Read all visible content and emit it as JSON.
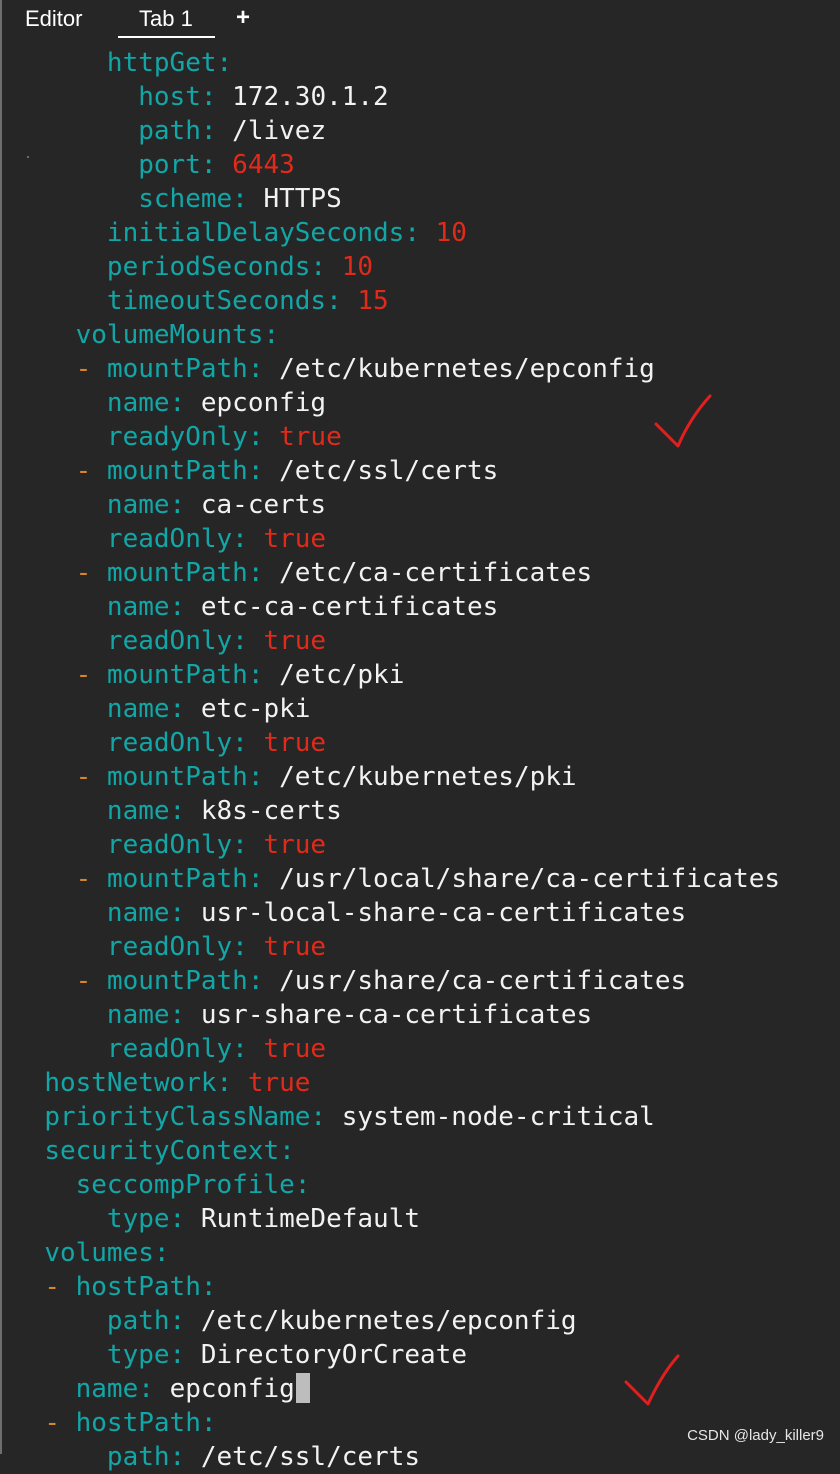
{
  "tabs": {
    "editor_label": "Editor",
    "tab1_label": "Tab 1",
    "add_label": "+"
  },
  "colors": {
    "background": "#262626",
    "key": "#12a6a7",
    "string_value": "#f2f2f2",
    "number_bool_value": "#e02a1a",
    "list_dash": "#d4862a",
    "annotation_check": "#e21f1f"
  },
  "code_lines": [
    {
      "indent": 6,
      "dash": false,
      "key": "httpGet",
      "value": "",
      "vtype": "none"
    },
    {
      "indent": 8,
      "dash": false,
      "key": "host",
      "value": "172.30.1.2",
      "vtype": "str"
    },
    {
      "indent": 8,
      "dash": false,
      "key": "path",
      "value": "/livez",
      "vtype": "str"
    },
    {
      "indent": 8,
      "dash": false,
      "key": "port",
      "value": "6443",
      "vtype": "num"
    },
    {
      "indent": 8,
      "dash": false,
      "key": "scheme",
      "value": "HTTPS",
      "vtype": "str"
    },
    {
      "indent": 6,
      "dash": false,
      "key": "initialDelaySeconds",
      "value": "10",
      "vtype": "num"
    },
    {
      "indent": 6,
      "dash": false,
      "key": "periodSeconds",
      "value": "10",
      "vtype": "num"
    },
    {
      "indent": 6,
      "dash": false,
      "key": "timeoutSeconds",
      "value": "15",
      "vtype": "num"
    },
    {
      "indent": 4,
      "dash": false,
      "key": "volumeMounts",
      "value": "",
      "vtype": "none"
    },
    {
      "indent": 4,
      "dash": true,
      "key": "mountPath",
      "value": "/etc/kubernetes/epconfig",
      "vtype": "str"
    },
    {
      "indent": 6,
      "dash": false,
      "key": "name",
      "value": "epconfig",
      "vtype": "str"
    },
    {
      "indent": 6,
      "dash": false,
      "key": "readyOnly",
      "value": "true",
      "vtype": "bool"
    },
    {
      "indent": 4,
      "dash": true,
      "key": "mountPath",
      "value": "/etc/ssl/certs",
      "vtype": "str"
    },
    {
      "indent": 6,
      "dash": false,
      "key": "name",
      "value": "ca-certs",
      "vtype": "str"
    },
    {
      "indent": 6,
      "dash": false,
      "key": "readOnly",
      "value": "true",
      "vtype": "bool"
    },
    {
      "indent": 4,
      "dash": true,
      "key": "mountPath",
      "value": "/etc/ca-certificates",
      "vtype": "str"
    },
    {
      "indent": 6,
      "dash": false,
      "key": "name",
      "value": "etc-ca-certificates",
      "vtype": "str"
    },
    {
      "indent": 6,
      "dash": false,
      "key": "readOnly",
      "value": "true",
      "vtype": "bool"
    },
    {
      "indent": 4,
      "dash": true,
      "key": "mountPath",
      "value": "/etc/pki",
      "vtype": "str"
    },
    {
      "indent": 6,
      "dash": false,
      "key": "name",
      "value": "etc-pki",
      "vtype": "str"
    },
    {
      "indent": 6,
      "dash": false,
      "key": "readOnly",
      "value": "true",
      "vtype": "bool"
    },
    {
      "indent": 4,
      "dash": true,
      "key": "mountPath",
      "value": "/etc/kubernetes/pki",
      "vtype": "str"
    },
    {
      "indent": 6,
      "dash": false,
      "key": "name",
      "value": "k8s-certs",
      "vtype": "str"
    },
    {
      "indent": 6,
      "dash": false,
      "key": "readOnly",
      "value": "true",
      "vtype": "bool"
    },
    {
      "indent": 4,
      "dash": true,
      "key": "mountPath",
      "value": "/usr/local/share/ca-certificates",
      "vtype": "str"
    },
    {
      "indent": 6,
      "dash": false,
      "key": "name",
      "value": "usr-local-share-ca-certificates",
      "vtype": "str"
    },
    {
      "indent": 6,
      "dash": false,
      "key": "readOnly",
      "value": "true",
      "vtype": "bool"
    },
    {
      "indent": 4,
      "dash": true,
      "key": "mountPath",
      "value": "/usr/share/ca-certificates",
      "vtype": "str"
    },
    {
      "indent": 6,
      "dash": false,
      "key": "name",
      "value": "usr-share-ca-certificates",
      "vtype": "str"
    },
    {
      "indent": 6,
      "dash": false,
      "key": "readOnly",
      "value": "true",
      "vtype": "bool"
    },
    {
      "indent": 2,
      "dash": false,
      "key": "hostNetwork",
      "value": "true",
      "vtype": "bool"
    },
    {
      "indent": 2,
      "dash": false,
      "key": "priorityClassName",
      "value": "system-node-critical",
      "vtype": "str"
    },
    {
      "indent": 2,
      "dash": false,
      "key": "securityContext",
      "value": "",
      "vtype": "none"
    },
    {
      "indent": 4,
      "dash": false,
      "key": "seccompProfile",
      "value": "",
      "vtype": "none"
    },
    {
      "indent": 6,
      "dash": false,
      "key": "type",
      "value": "RuntimeDefault",
      "vtype": "str"
    },
    {
      "indent": 2,
      "dash": false,
      "key": "volumes",
      "value": "",
      "vtype": "none"
    },
    {
      "indent": 2,
      "dash": true,
      "key": "hostPath",
      "value": "",
      "vtype": "none"
    },
    {
      "indent": 6,
      "dash": false,
      "key": "path",
      "value": "/etc/kubernetes/epconfig",
      "vtype": "str"
    },
    {
      "indent": 6,
      "dash": false,
      "key": "type",
      "value": "DirectoryOrCreate",
      "vtype": "str"
    },
    {
      "indent": 4,
      "dash": false,
      "key": "name",
      "value": "epconfig",
      "vtype": "str",
      "cursor": true
    },
    {
      "indent": 2,
      "dash": true,
      "key": "hostPath",
      "value": "",
      "vtype": "none"
    },
    {
      "indent": 6,
      "dash": false,
      "key": "path",
      "value": "/etc/ssl/certs",
      "vtype": "str"
    }
  ],
  "annotations": {
    "checkmarks": [
      "checkmark-icon",
      "checkmark-icon"
    ]
  },
  "watermark": "CSDN @lady_killer9"
}
